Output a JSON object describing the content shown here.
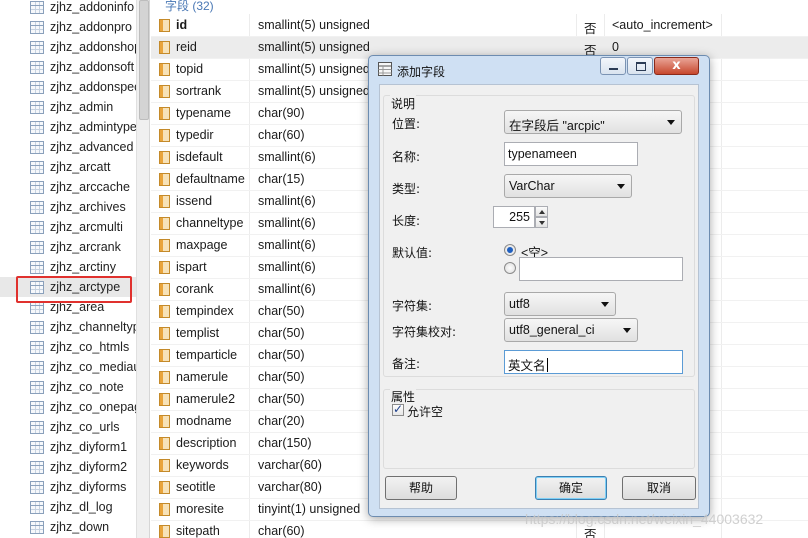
{
  "tree": {
    "items": [
      "zjhz_addoninfo",
      "zjhz_addonpro",
      "zjhz_addonshop",
      "zjhz_addonsoft",
      "zjhz_addonspec",
      "zjhz_admin",
      "zjhz_admintype",
      "zjhz_advanced",
      "zjhz_arcatt",
      "zjhz_arccache",
      "zjhz_archives",
      "zjhz_arcmulti",
      "zjhz_arcrank",
      "zjhz_arctiny",
      "zjhz_arctype",
      "zjhz_area",
      "zjhz_channeltype",
      "zjhz_co_htmls",
      "zjhz_co_mediau",
      "zjhz_co_note",
      "zjhz_co_onepage",
      "zjhz_co_urls",
      "zjhz_diyform1",
      "zjhz_diyform2",
      "zjhz_diyforms",
      "zjhz_dl_log",
      "zjhz_down"
    ],
    "selected_index": 14
  },
  "fields": {
    "header": "字段 (32)",
    "rows": [
      {
        "name": "id",
        "type": "smallint(5) unsigned",
        "null": "否",
        "default": "<auto_increment>"
      },
      {
        "name": "reid",
        "type": "smallint(5) unsigned",
        "null": "否",
        "default": "0"
      },
      {
        "name": "topid",
        "type": "smallint(5) unsigned",
        "null": "",
        "default": ""
      },
      {
        "name": "sortrank",
        "type": "smallint(5) unsigned",
        "null": "",
        "default": ""
      },
      {
        "name": "typename",
        "type": "char(90)",
        "null": "",
        "default": ""
      },
      {
        "name": "typedir",
        "type": "char(60)",
        "null": "",
        "default": ""
      },
      {
        "name": "isdefault",
        "type": "smallint(6)",
        "null": "",
        "default": ""
      },
      {
        "name": "defaultname",
        "type": "char(15)",
        "null": "",
        "default": ""
      },
      {
        "name": "issend",
        "type": "smallint(6)",
        "null": "",
        "default": ""
      },
      {
        "name": "channeltype",
        "type": "smallint(6)",
        "null": "",
        "default": ""
      },
      {
        "name": "maxpage",
        "type": "smallint(6)",
        "null": "",
        "default": ""
      },
      {
        "name": "ispart",
        "type": "smallint(6)",
        "null": "",
        "default": ""
      },
      {
        "name": "corank",
        "type": "smallint(6)",
        "null": "",
        "default": ""
      },
      {
        "name": "tempindex",
        "type": "char(50)",
        "null": "",
        "default": ""
      },
      {
        "name": "templist",
        "type": "char(50)",
        "null": "",
        "default": ""
      },
      {
        "name": "temparticle",
        "type": "char(50)",
        "null": "",
        "default": ""
      },
      {
        "name": "namerule",
        "type": "char(50)",
        "null": "",
        "default": ""
      },
      {
        "name": "namerule2",
        "type": "char(50)",
        "null": "",
        "default": ""
      },
      {
        "name": "modname",
        "type": "char(20)",
        "null": "",
        "default": ""
      },
      {
        "name": "description",
        "type": "char(150)",
        "null": "",
        "default": ""
      },
      {
        "name": "keywords",
        "type": "varchar(60)",
        "null": "",
        "default": ""
      },
      {
        "name": "seotitle",
        "type": "varchar(80)",
        "null": "",
        "default": ""
      },
      {
        "name": "moresite",
        "type": "tinyint(1) unsigned",
        "null": "",
        "default": ""
      },
      {
        "name": "sitepath",
        "type": "char(60)",
        "null": "否",
        "default": ""
      }
    ],
    "selected_index": 1
  },
  "dialog": {
    "title": "添加字段",
    "section_label": "说明",
    "position_label": "位置:",
    "position_value": "在字段后 \"arcpic\"",
    "name_label": "名称:",
    "name_value": "typenameen",
    "type_label": "类型:",
    "type_value": "VarChar",
    "length_label": "长度:",
    "length_value": "255",
    "default_label": "默认值:",
    "default_empty_option": "<空>",
    "default_custom_value": "",
    "charset_label": "字符集:",
    "charset_value": "utf8",
    "collation_label": "字符集校对:",
    "collation_value": "utf8_general_ci",
    "comment_label": "备注:",
    "comment_value": "英文名",
    "props_label": "属性",
    "allow_null_label": "允许空",
    "allow_null_checked": true,
    "help_label": "帮助",
    "ok_label": "确定",
    "cancel_label": "取消",
    "close_glyph": "x"
  },
  "watermark": "https://blog.csdn.net/weixin_44003632"
}
